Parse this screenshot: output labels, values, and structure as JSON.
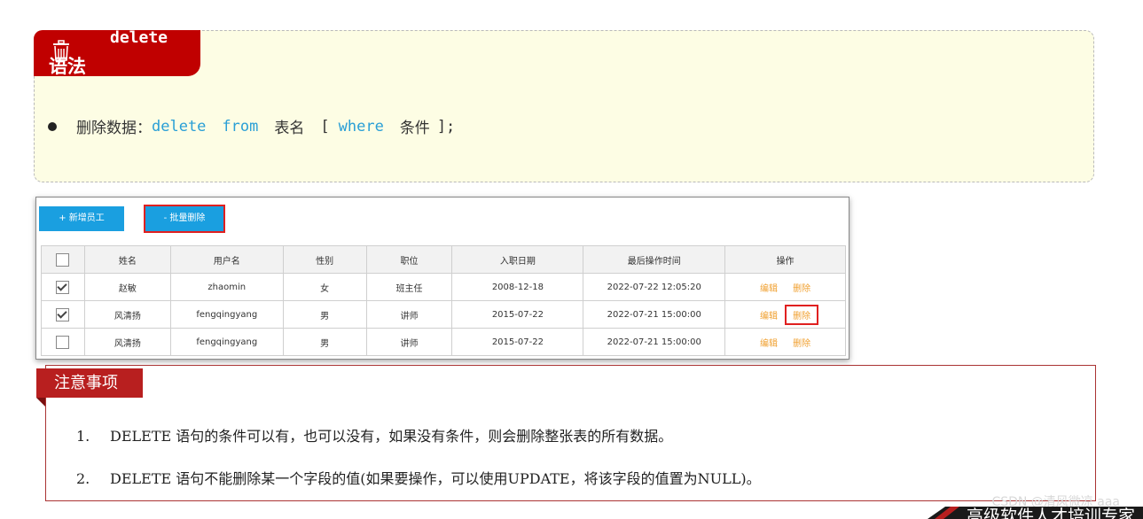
{
  "syntax": {
    "tab_title": "delete",
    "tab_subtitle": "语法",
    "label": "删除数据：",
    "kw_delete": "delete",
    "kw_from": "from",
    "table_name": "表名",
    "bracket_open": "[",
    "kw_where": "where",
    "condition": "条件",
    "bracket_close": "];"
  },
  "toolbar": {
    "add_label": "+ 新增员工",
    "batch_delete_label": "- 批量删除"
  },
  "table": {
    "headers": [
      "姓名",
      "用户名",
      "性别",
      "职位",
      "入职日期",
      "最后操作时间",
      "操作"
    ],
    "rows": [
      {
        "checked": true,
        "name": "赵敏",
        "username": "zhaomin",
        "gender": "女",
        "position": "班主任",
        "entry_date": "2008-12-18",
        "last_op": "2022-07-22 12:05:20",
        "edit": "编辑",
        "delete": "删除"
      },
      {
        "checked": true,
        "name": "风清扬",
        "username": "fengqingyang",
        "gender": "男",
        "position": "讲师",
        "entry_date": "2015-07-22",
        "last_op": "2022-07-21 15:00:00",
        "edit": "编辑",
        "delete": "删除"
      },
      {
        "checked": false,
        "name": "风清扬",
        "username": "fengqingyang",
        "gender": "男",
        "position": "讲师",
        "entry_date": "2015-07-22",
        "last_op": "2022-07-21 15:00:00",
        "edit": "编辑",
        "delete": "删除"
      }
    ]
  },
  "notes": {
    "title": "注意事项",
    "items": [
      {
        "num": "1.",
        "text": "DELETE 语句的条件可以有，也可以没有，如果没有条件，则会删除整张表的所有数据。"
      },
      {
        "num": "2.",
        "text": "DELETE 语句不能删除某一个字段的值(如果要操作，可以使用UPDATE，将该字段的值置为NULL)。"
      }
    ]
  },
  "watermark": "CSDN @清风微凉 aaa",
  "footer_banner": "高级软件人才培训专家",
  "colors": {
    "brand_red": "#c00000",
    "accent_blue": "#1a9fe0",
    "keyword_blue": "#2a9fd6",
    "action_orange": "#f0a030"
  }
}
